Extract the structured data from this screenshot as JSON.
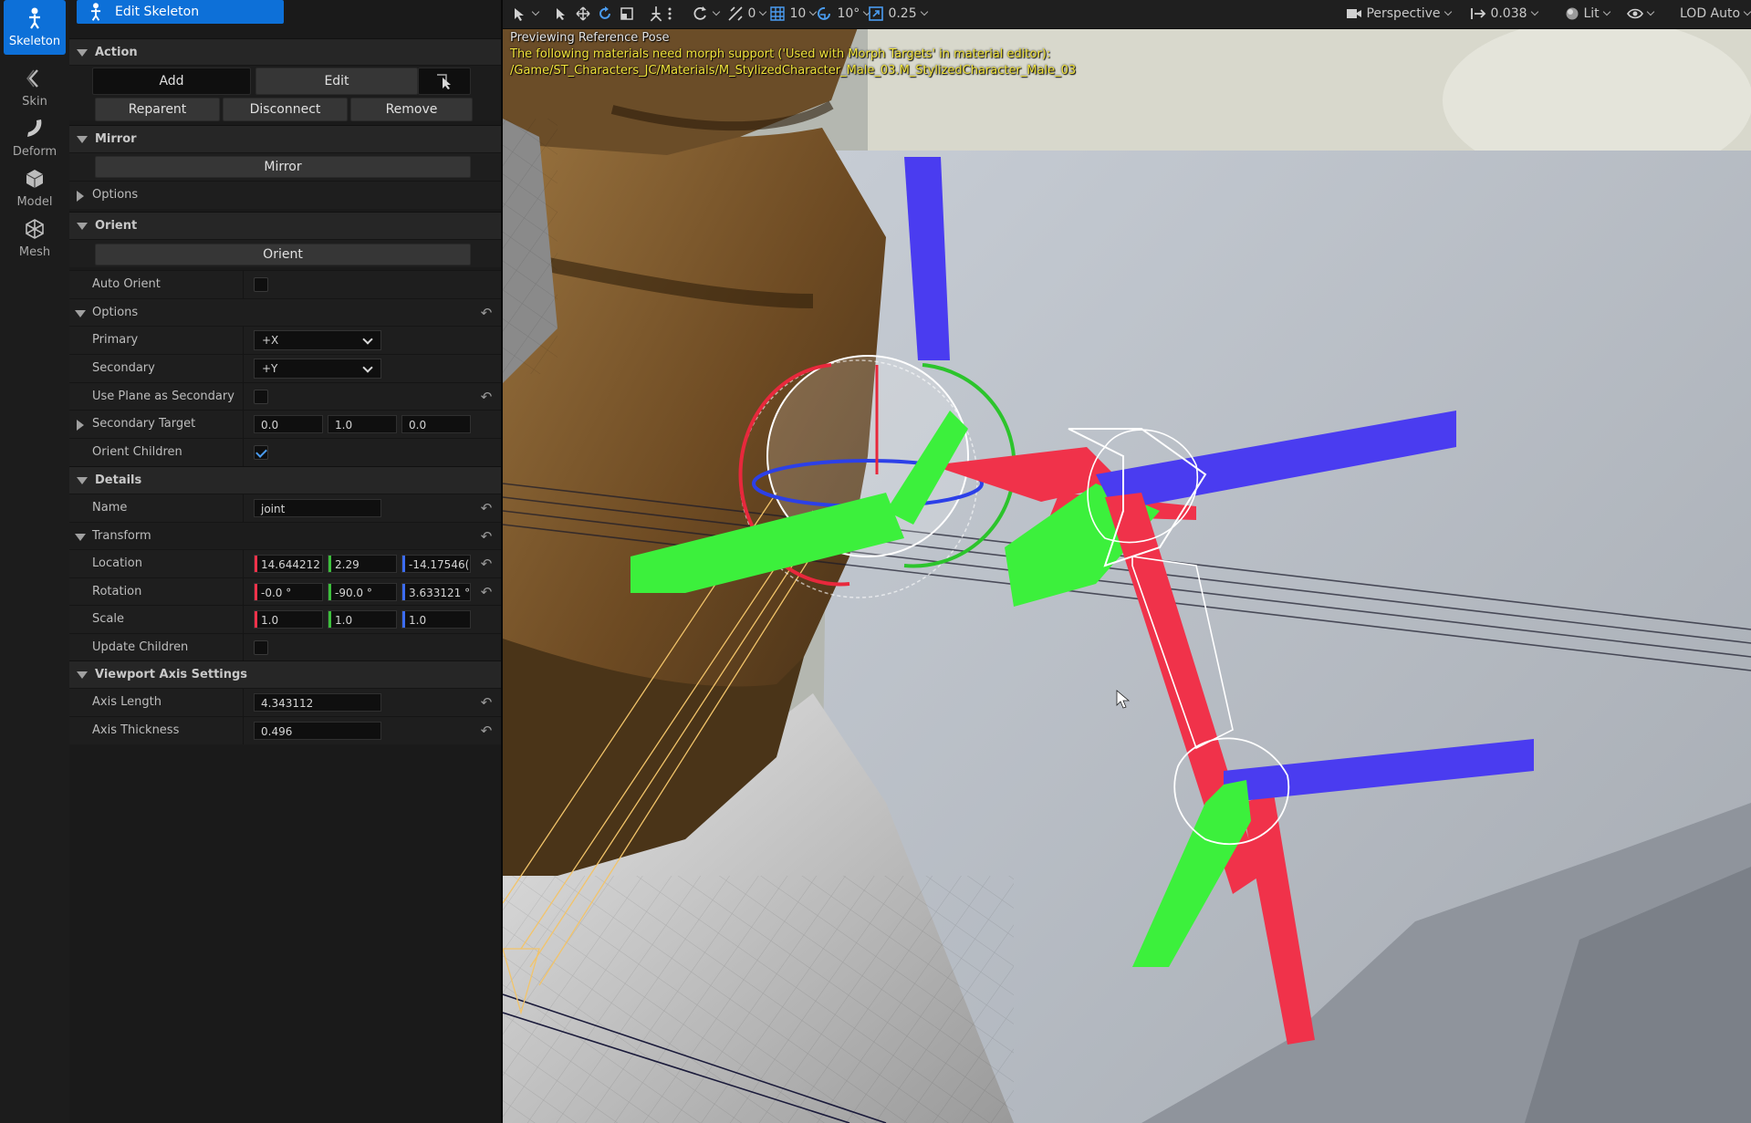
{
  "modes": [
    {
      "label": "Skeleton",
      "icon": "skeleton-icon",
      "active": true
    },
    {
      "label": "Skin",
      "icon": "skin-icon"
    },
    {
      "label": "Deform",
      "icon": "deform-icon"
    },
    {
      "label": "Model",
      "icon": "model-icon"
    },
    {
      "label": "Mesh",
      "icon": "mesh-icon"
    }
  ],
  "tool_tab": {
    "label": "Edit Skeleton",
    "icon": "skeleton-icon"
  },
  "sections": {
    "action": "Action",
    "mirror": "Mirror",
    "orient": "Orient",
    "details": "Details",
    "viewport_axis": "Viewport Axis Settings"
  },
  "action": {
    "add": "Add",
    "edit": "Edit",
    "reparent": "Reparent",
    "disconnect": "Disconnect",
    "remove": "Remove"
  },
  "mirror": {
    "button": "Mirror",
    "options": "Options"
  },
  "orient": {
    "button": "Orient",
    "auto_orient": "Auto Orient",
    "options": "Options",
    "primary_label": "Primary",
    "primary_value": "+X",
    "secondary_label": "Secondary",
    "secondary_value": "+Y",
    "use_plane_label": "Use Plane as Secondary",
    "secondary_target_label": "Secondary Target",
    "secondary_target": [
      "0.0",
      "1.0",
      "0.0"
    ],
    "orient_children_label": "Orient Children"
  },
  "details": {
    "name_label": "Name",
    "name_value": "joint",
    "transform_label": "Transform",
    "location_label": "Location",
    "location": [
      "14.644212",
      "2.29",
      "-14.17546("
    ],
    "rotation_label": "Rotation",
    "rotation": [
      "-0.0 °",
      "-90.0 °",
      "3.633121 °"
    ],
    "scale_label": "Scale",
    "scale": [
      "1.0",
      "1.0",
      "1.0"
    ],
    "update_children_label": "Update Children"
  },
  "viewport_axis": {
    "axis_length_label": "Axis Length",
    "axis_length": "4.343112",
    "axis_thickness_label": "Axis Thickness",
    "axis_thickness": "0.496"
  },
  "toolbar": {
    "rot_snap": "0",
    "grid_snap": "10",
    "angle_snap": "10°",
    "scale_snap": "0.25",
    "perspective": "Perspective",
    "camera_speed": "0.038",
    "lit": "Lit",
    "lod": "LOD Auto"
  },
  "viewport": {
    "preview_msg": "Previewing Reference Pose",
    "warning": "The following materials need morph support ('Used with Morph Targets' in material editor):",
    "material_path": "/Game/ST_Characters_JC/Materials/M_StylizedCharacter_Male_03.M_StylizedCharacter_Male_03"
  },
  "colors": {
    "accent": "#0d70d8",
    "axis_x": "#f0324a",
    "axis_y": "#3cf03c",
    "axis_z": "#4a3cf0",
    "warning": "#f2e43c"
  }
}
